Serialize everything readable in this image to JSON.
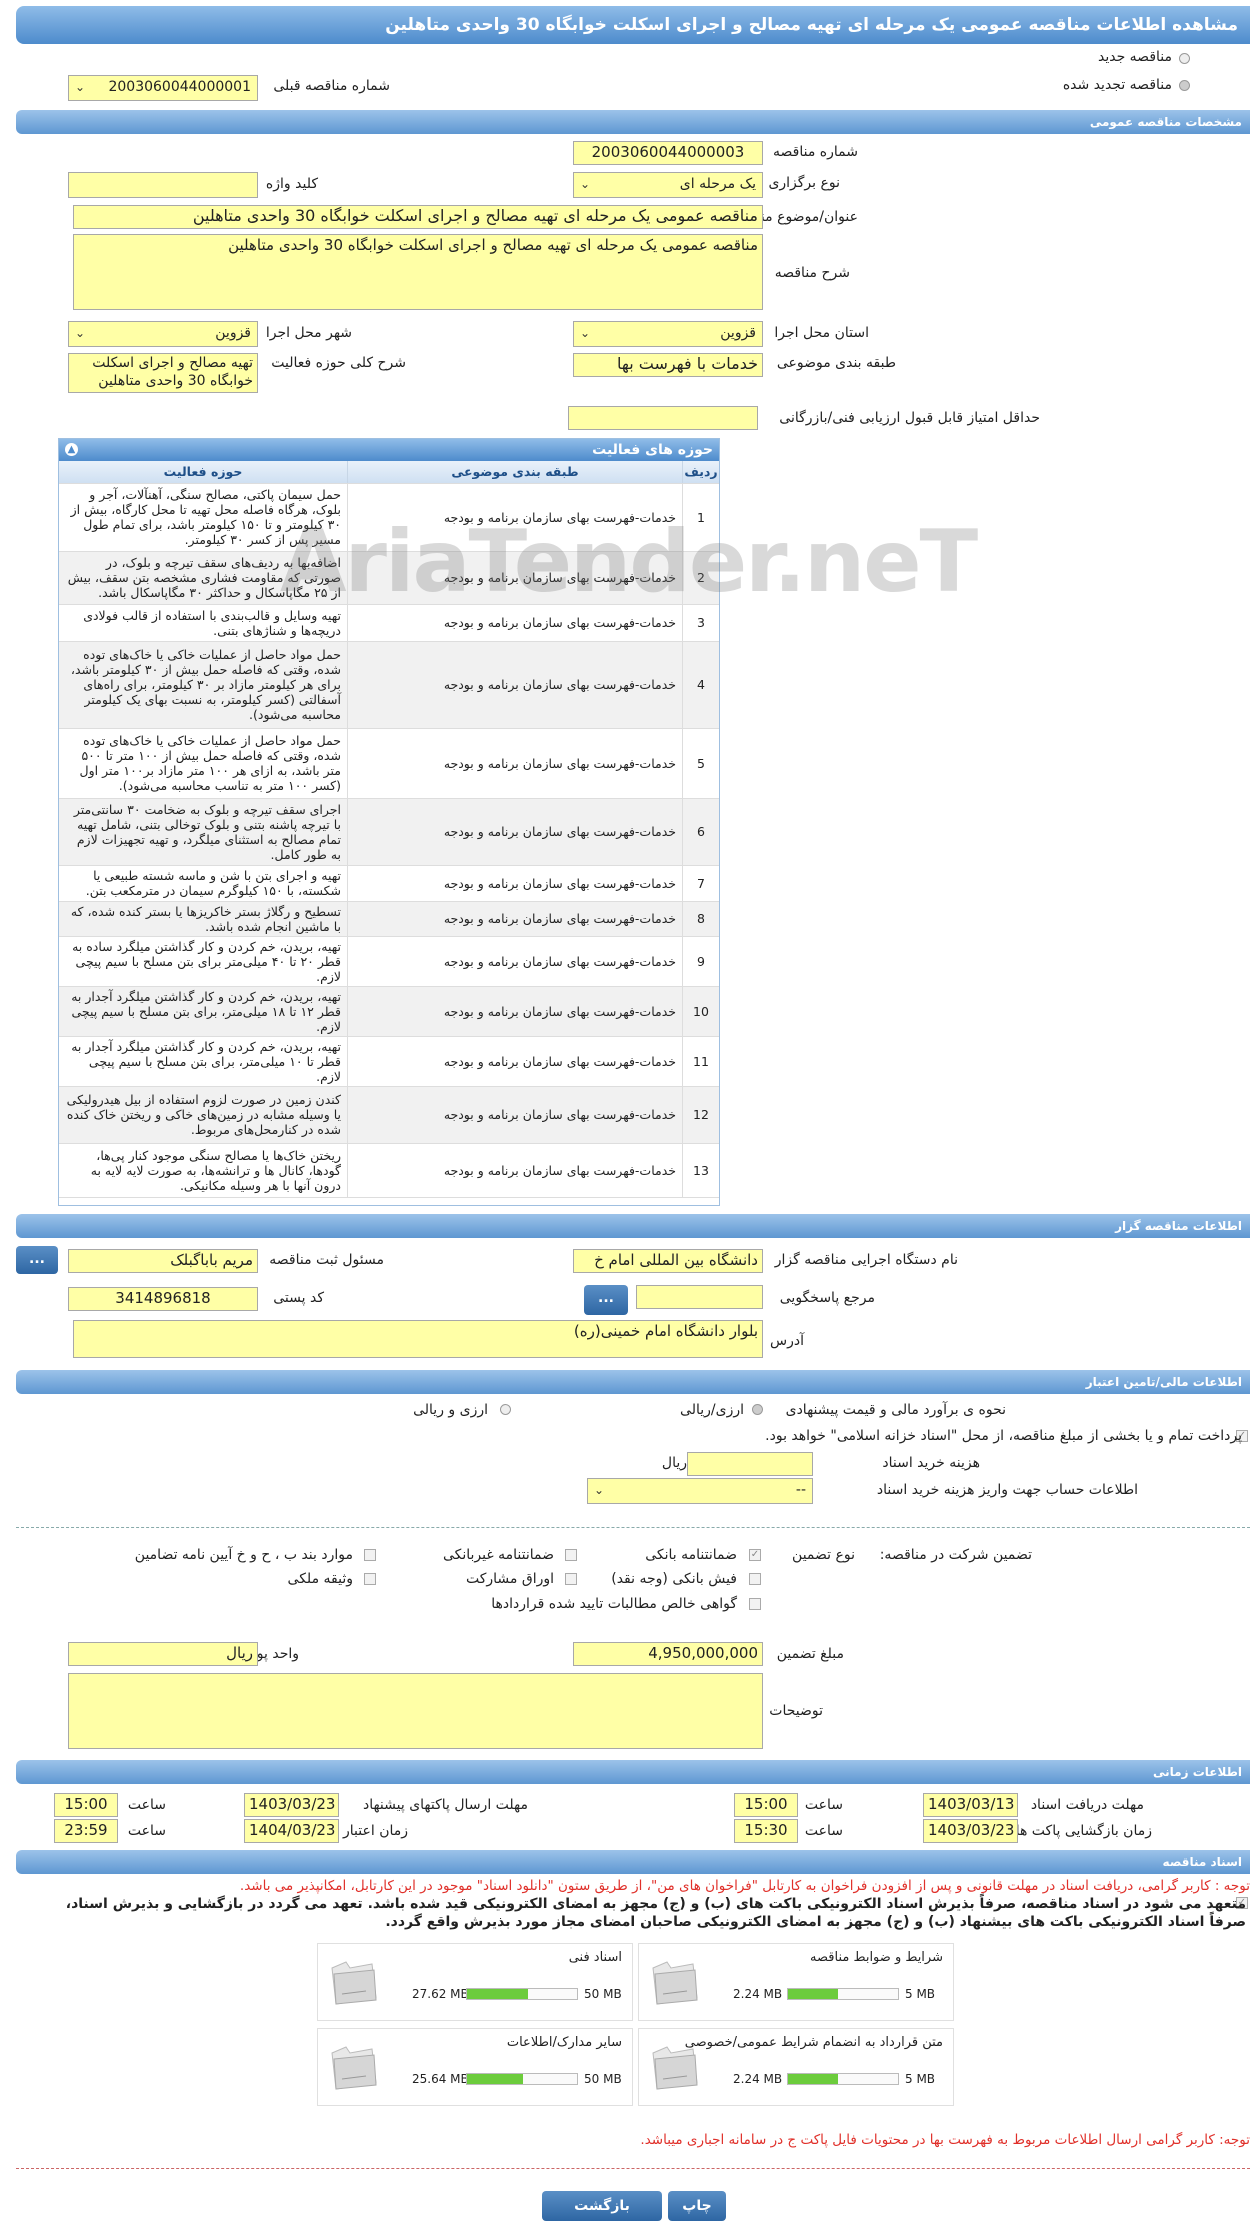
{
  "title": "مشاهده اطلاعات مناقصه عمومی یک مرحله ای تهیه مصالح و اجرای اسکلت خوابگاه 30 واحدی متاهلین",
  "tender_type": {
    "new_label": "مناقصه جدید",
    "renewed_label": "مناقصه تجدید شده",
    "prev_number_label": "شماره مناقصه قبلی",
    "prev_number": "2003060044000001"
  },
  "general": {
    "header": "مشخصات مناقصه عمومی",
    "number_label": "شماره مناقصه",
    "number": "2003060044000003",
    "hold_type_label": "نوع برگزاری",
    "hold_type": "یک مرحله ای",
    "keyword_label": "کلید واژه",
    "keyword": "",
    "subject_label": "عنوان/موضوع مناقصه",
    "subject": "مناقصه عمومی یک مرحله ای تهیه مصالح و اجرای اسکلت خوابگاه 30 واحدی متاهلین",
    "description_label": "شرح مناقصه",
    "description": "مناقصه عمومی یک مرحله ای تهیه مصالح و اجرای اسکلت خوابگاه 30 واحدی متاهلین",
    "province_label": "استان محل اجرا",
    "province": "قزوین",
    "city_label": "شهر محل اجرا",
    "city": "قزوین",
    "category_label": "طبقه بندی موضوعی",
    "category": "خدمات با فهرست بها",
    "activity_desc_label": "شرح کلی حوزه فعالیت",
    "activity_desc": "تهیه مصالح و اجرای اسکلت خوابگاه 30 واحدی متاهلین",
    "min_score_label": "حداقل امتیاز قابل قبول ارزیابی فنی/بازرگانی",
    "min_score": ""
  },
  "activities": {
    "header": "حوزه های فعالیت",
    "columns": [
      "ردیف",
      "طبقه بندی موضوعی",
      "حوزه فعالیت"
    ],
    "rows": [
      {
        "n": "1",
        "cat": "خدمات-فهرست بهای سازمان برنامه و بودجه",
        "act": "حمل سیمان پاکتی، مصالح سنگی، آهنآلات، آجر و بلوک، هرگاه فاصله محل تهیه تا محل کارگاه، بیش از ۳۰ کیلومتر و تا ۱۵۰ کیلومتر باشد، برای تمام طول مسیر پس از کسر ۳۰ کیلومتر."
      },
      {
        "n": "2",
        "cat": "خدمات-فهرست بهای سازمان برنامه و بودجه",
        "act": "اضافه‌بها به ردیف‌های سقف تیرچه و بلوک، در صورتی که مقاومت فشاری مشخصه بتن سقف، بیش از ۲۵ مگاپاسکال و حداکثر ۳۰ مگاپاسکال باشد."
      },
      {
        "n": "3",
        "cat": "خدمات-فهرست بهای سازمان برنامه و بودجه",
        "act": "تهیه وسایل و قالب‌بندی با استفاده از قالب فولادی دریچه‌ها و شناژهای بتنی."
      },
      {
        "n": "4",
        "cat": "خدمات-فهرست بهای سازمان برنامه و بودجه",
        "act": "حمل مواد حاصل از عملیات خاکی یا خاک‌های توده شده، وقتی که فاصله حمل بیش از ۳۰ کیلومتر باشد، برای هر کیلومتر مازاد بر ۳۰ کیلومتر، برای راه‌های آسفالتی (کسر کیلومتر، به نسبت بهای یک کیلومتر محاسبه می‌شود)."
      },
      {
        "n": "5",
        "cat": "خدمات-فهرست بهای سازمان برنامه و بودجه",
        "act": "حمل مواد حاصل از عملیات خاکی یا خاک‌های توده شده، وقتی که فاصله حمل بیش از ۱۰۰ متر تا ۵۰۰ متر باشد، به ازای هر ۱۰۰ متر مازاد بر۱۰۰ متر اول (کسر ۱۰۰ متر به تناسب محاسبه می‌شود)."
      },
      {
        "n": "6",
        "cat": "خدمات-فهرست بهای سازمان برنامه و بودجه",
        "act": "اجرای سقف تیرچه و بلوک به ضخامت ۳۰ سانتی‌متر با تیرچه پاشنه بتنی و بلوک توخالی بتنی، شامل تهیه تمام مصالح به استثنای میلگرد، و تهیه تجهیزات لازم به طور کامل."
      },
      {
        "n": "7",
        "cat": "خدمات-فهرست بهای سازمان برنامه و بودجه",
        "act": "تهیه و اجرای بتن با شن و ماسه شسته طبیعی یا شکسته، با ۱۵۰ کیلوگرم سیمان در مترمکعب بتن."
      },
      {
        "n": "8",
        "cat": "خدمات-فهرست بهای سازمان برنامه و بودجه",
        "act": "تسطیح و رگلاژ بستر خاکریزها یا بستر کنده شده، که با ماشین انجام شده باشد."
      },
      {
        "n": "9",
        "cat": "خدمات-فهرست بهای سازمان برنامه و بودجه",
        "act": "تهیه، بریدن، خم کردن و کار گذاشتن میلگرد ساده به قطر ۲۰ تا ۴۰ میلی‌متر برای بتن مسلح با سیم پیچی لازم."
      },
      {
        "n": "10",
        "cat": "خدمات-فهرست بهای سازمان برنامه و بودجه",
        "act": "تهیه، بریدن، خم کردن و کار گذاشتن میلگرد آجدار به قطر ۱۲ تا ۱۸ میلی‌متر، برای بتن مسلح با سیم پیچی لازم."
      },
      {
        "n": "11",
        "cat": "خدمات-فهرست بهای سازمان برنامه و بودجه",
        "act": "تهیه، بریدن، خم کردن و کار گذاشتن میلگرد آجدار به قطر تا ۱۰ میلی‌متر، برای بتن مسلح با سیم پیچی لازم."
      },
      {
        "n": "12",
        "cat": "خدمات-فهرست بهای سازمان برنامه و بودجه",
        "act": "کندن زمین در صورت لزوم استفاده از بیل هیدرولیکی یا وسیله مشابه در زمین‌های خاکی و ریختن خاک کنده شده در کنارمحل‌های مربوط."
      },
      {
        "n": "13",
        "cat": "خدمات-فهرست بهای سازمان برنامه و بودجه",
        "act": "ریختن خاک‌ها یا مصالح سنگی موجود کنار پی‌ها، گودها، کانال ها و ترانشه‌ها، به صورت لایه لایه به درون آنها با هر وسیله مکانیکی."
      }
    ]
  },
  "organizer": {
    "header": "اطلاعات مناقصه گزار",
    "org_label": "نام دستگاه اجرایی مناقصه گزار",
    "org": "دانشگاه بین المللی امام خ",
    "registrar_label": "مسئول ثبت مناقصه",
    "registrar": "مریم باباگبلک",
    "ref_label": "مرجع پاسخگویی",
    "ref": "",
    "postal_label": "کد پستی",
    "postal": "3414896818",
    "address_label": "آدرس",
    "address": "بلوار دانشگاه امام خمینی(ره)",
    "dots": "..."
  },
  "finance": {
    "header": "اطلاعات مالی/تامین اعتبار",
    "estimate_label": "نحوه ی برآورد مالی و قیمت پیشنهادی",
    "opt1": "ارزی/ریالی",
    "opt2": "ارزی و ریالی",
    "treasury_text": "پرداخت تمام و یا بخشی از مبلغ مناقصه، از محل \"اسناد خزانه اسلامی\" خواهد بود.",
    "doc_cost_label": "هزینه خرید اسناد",
    "doc_cost": "",
    "currency": "ریال",
    "account_label": "اطلاعات حساب جهت واریز هزینه خرید اسناد",
    "account": "--"
  },
  "guarantee": {
    "label": "تضمین شرکت در مناقصه:",
    "type_label": "نوع تضمین",
    "options": [
      "ضمانتنامه بانکی",
      "ضمانتنامه غیربانکی",
      "موارد بند ب ، ح و خ آیین نامه تضامین",
      "فیش بانکی (وجه نقد)",
      "اوراق مشارکت",
      "وثیقه ملکی",
      "گواهی خالص مطالبات تایید شده قراردادها"
    ],
    "amount_label": "مبلغ تضمین",
    "amount": "4,950,000,000",
    "unit_label": "واحد پول",
    "unit": "ریال",
    "notes_label": "توضیحات",
    "notes": ""
  },
  "timing": {
    "header": "اطلاعات زمانی",
    "receive_label": "مهلت دریافت اسناد",
    "receive_date": "1403/03/13",
    "receive_time": "15:00",
    "send_label": "مهلت ارسال پاکتهای پیشنهاد",
    "send_date": "1403/03/23",
    "send_time": "15:00",
    "open_label": "زمان بازگشایی پاکت ها",
    "open_date": "1403/03/23",
    "open_time": "15:30",
    "valid_label": "زمان اعتبار پیشنهاد",
    "valid_date": "1404/03/23",
    "valid_time": "23:59",
    "time_label": "ساعت"
  },
  "documents": {
    "header": "اسناد مناقصه",
    "note_red": "توجه : کاربر گرامی، دریافت اسناد در مهلت قانونی و پس از افزودن فراخوان به کارتابل \"فراخوان های من\"، از طریق ستون \"دانلود اسناد\" موجود در این کارتابل، امکانپذیر می باشد.",
    "commit_line1": "متعهد می شود در اسناد مناقصه، صرفاً بذیرش اسناد الکترونیکی باکت های (ب) و (ج) مجهز به امضای الکترونیکی قید شده باشد. تعهد می گردد در بازگشایی و بذیرش اسناد،",
    "commit_line2": "صرفاً اسناد الکترونیکی باکت های بیشنهاد (ب) و (ج) مجهز به امضای الکترونیکی صاحبان امضای مجاز مورد بذیرش واقع گردد.",
    "files": [
      {
        "name": "شرایط و ضوابط مناقصه",
        "size": "2.24 MB",
        "max": "5 MB",
        "fill": 0.45
      },
      {
        "name": "اسناد فنی",
        "size": "27.62 MB",
        "max": "50 MB",
        "fill": 0.55
      },
      {
        "name": "متن قرارداد به انضمام شرایط عمومی/خصوصی",
        "size": "2.24 MB",
        "max": "5 MB",
        "fill": 0.45
      },
      {
        "name": "سایر مدارک/اطلاعات",
        "size": "25.64 MB",
        "max": "50 MB",
        "fill": 0.51
      }
    ],
    "note_bottom": "توجه: کاربر گرامی ارسال اطلاعات مربوط به فهرست بها در محتویات فایل پاکت ج در سامانه اجباری میباشد."
  },
  "buttons": {
    "print": "چاپ",
    "back": "بازگشت"
  },
  "watermark": "AriaTender.neT",
  "colors": {
    "header_bar": "#5e97d2",
    "input_bg": "#ffffa6",
    "progress": "#6ccc3c",
    "note_red": "#e0302a"
  }
}
